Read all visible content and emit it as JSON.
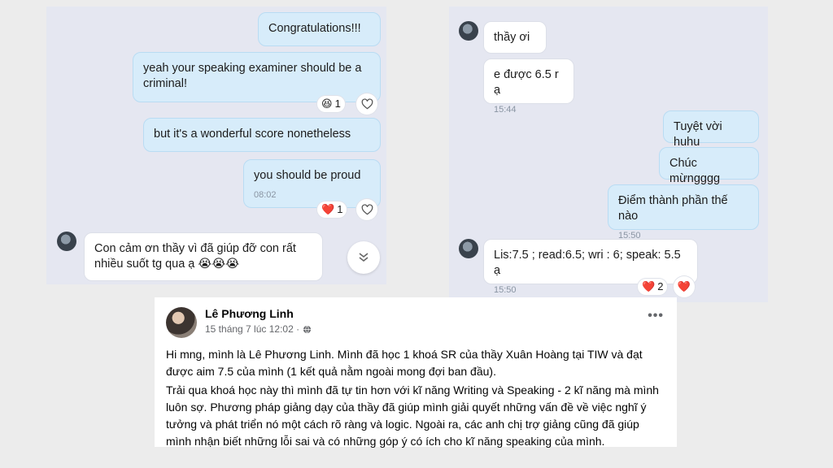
{
  "left_chat": {
    "messages": {
      "m1": "Congratulations!!!",
      "m2": "yeah your speaking examiner should be a criminal!",
      "m2_reaction": {
        "emoji": "😆",
        "count": "1"
      },
      "m3": "but it's a wonderful score nonetheless",
      "m4": "you should be proud",
      "m4_time": "08:02",
      "m4_reaction": {
        "emoji": "❤️",
        "count": "1"
      },
      "m5": "Con cảm ơn thầy vì đã giúp đỡ con rất nhiều suốt tg qua ạ 😭😭😭"
    },
    "icons": [
      "heart-outline-icon",
      "chevron-double-down-icon"
    ]
  },
  "right_chat": {
    "messages": {
      "r1": "thầy ơi",
      "r2": "e được 6.5 r ạ",
      "r2_time": "15:44",
      "r3": "Tuyệt vời huhu",
      "r4": "Chúc mừngggg",
      "r5": "Điểm thành phần thế nào",
      "r5_time": "15:50",
      "r6": "Lis:7.5 ; read:6.5; wri : 6; speak: 5.5 ạ",
      "r6_time": "15:50",
      "r6_reaction": {
        "emoji": "❤️",
        "count": "2"
      },
      "r6_heart": "❤️"
    }
  },
  "facebook_post": {
    "author": "Lê Phương Linh",
    "timestamp": "15 tháng 7 lúc 12:02 ·",
    "more": "•••",
    "paragraph1": "Hi mng, mình là Lê Phương Linh. Mình đã học 1 khoá SR của thầy Xuân Hoàng tại TIW và đạt được aim 7.5 của mình (1 kết quả nằm ngoài mong đợi ban đầu).",
    "paragraph2": "Trải qua khoá học này thì mình đã tự tin hơn với kĩ năng Writing và Speaking - 2 kĩ năng mà mình luôn sợ. Phương pháp giảng dạy của thầy đã giúp mình giải quyết những vấn đề về việc nghĩ ý tưởng và phát triển nó một cách rõ ràng và logic. Ngoài ra, các anh chị trợ giảng cũng đã giúp mình nhận biết những lỗi sai và có những góp ý có ích cho kĩ năng speaking của mình."
  },
  "colors": {
    "chat_bg": "#e5e7f1",
    "outgoing_bubble": "#d7ecfa",
    "incoming_bubble": "#ffffff",
    "heart": "#e0245e"
  }
}
